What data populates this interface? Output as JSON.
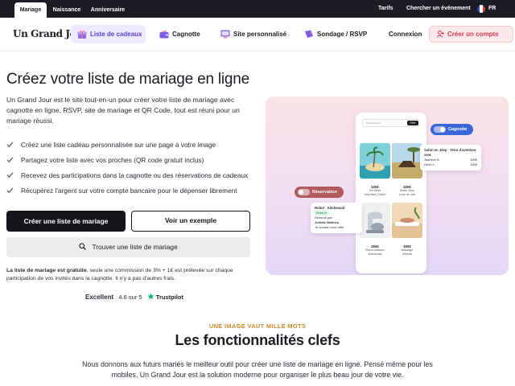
{
  "topbar": {
    "tabs": [
      "Mariage",
      "Naissance",
      "Anniversaire"
    ],
    "links": [
      "Tarifs",
      "Chercher un évènement"
    ],
    "lang": "FR"
  },
  "nav": {
    "logo": "Un Grand Jour",
    "items": [
      "Liste de cadeaux",
      "Cagnotte",
      "Site personnalisé",
      "Sondage / RSVP"
    ],
    "login": "Connexion",
    "signup": "Créer un compte"
  },
  "hero": {
    "title": "Créez votre liste de mariage en ligne",
    "intro": "Un Grand Jour est le site tout-en-un pour créer votre liste de mariage avec cagnotte en ligne, RSVP, site de mariage et QR Code, tout est réuni pour un mariage réussi.",
    "features": [
      "Créez une liste cadeau personnalisée sur une page à votre image",
      "Partagez votre liste avec vos proches (QR code gratuit inclus)",
      "Recevez des participations dans la cagnotte ou des réservations de cadeaux",
      "Récupérez l'argent sur votre compte bancaire pour le dépenser librement"
    ],
    "cta_create": "Créer une liste de mariage",
    "cta_example": "Voir un exemple",
    "cta_find": "Trouver une liste de mariage",
    "note_bold": "La liste de mariage est gratuite",
    "note_rest": ", seule une commission de 3% + 1€ est prélevée sur chaque participation de vos invités dans la cagnotte. Il n'y a pas d'autres frais.",
    "rating_label": "Excellent",
    "rating_value": "4.8 sur 5",
    "rating_brand": "Trustpilot"
  },
  "illustration": {
    "search_placeholder": "Rechercher...",
    "search_button": "Offrir",
    "pill_cagnotte": "Cagnotte",
    "pill_reservation": "Réservation",
    "gifts": [
      {
        "price": "120€",
        "name": "Vie Arbre",
        "sub": "Vola Avie | Safari"
      },
      {
        "price": "320€",
        "name": "Safari Jeep",
        "sub": "Lune de miel"
      },
      {
        "price": "250€",
        "name": "Robot pâtissier",
        "sub": "Kitchenaid"
      },
      {
        "price": "300€",
        "name": "Massage",
        "sub": "Détente"
      }
    ],
    "card_cagnotte": {
      "title": "Safari en Jeep · Terre d'aventure",
      "amount": "250€",
      "line1": "Jasmine B.",
      "line1_amount": "150€",
      "line2": "Henri L.",
      "line2_amount": "100€"
    },
    "card_reservation": {
      "title": "Robot · Kitchenaid",
      "badge": "Réservé",
      "line1": "Réservé par",
      "line2": "Juliette Mathieu",
      "line3": "Je voulais vous offrir"
    }
  },
  "features_section": {
    "eyebrow": "UNE IMAGE VAUT MILLE MOTS",
    "title": "Les fonctionnalités clefs",
    "description": "Nous donnons aux futurs mariés le meilleur outil pour créer une liste de mariage en ligne. Pensé même pour les mobiles, Un Grand Jour est la solution moderne pour organiser le plus beau jour de votre vie."
  }
}
